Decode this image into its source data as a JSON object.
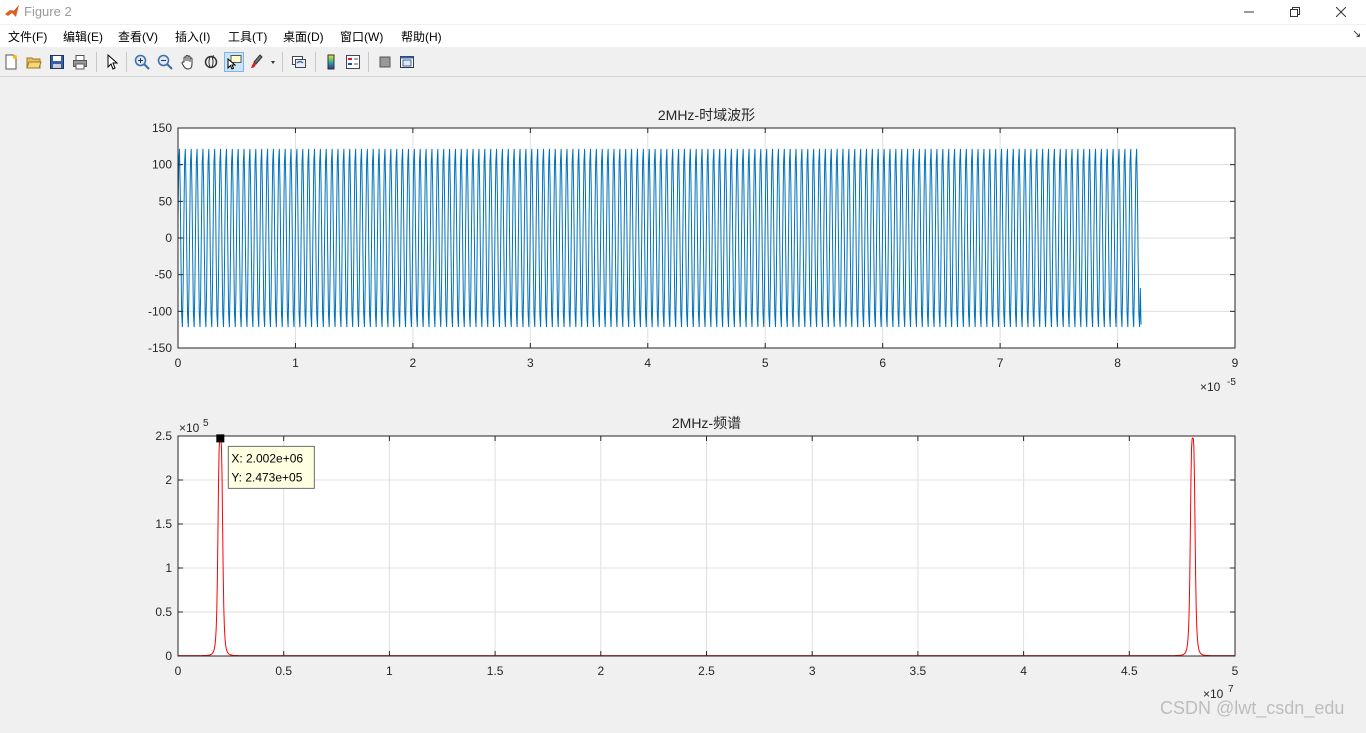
{
  "window": {
    "title": "Figure 2",
    "app_icon": "matlab-icon",
    "controls": [
      "minimize-icon",
      "maximize-icon",
      "close-icon"
    ]
  },
  "menu": [
    "文件(F)",
    "编辑(E)",
    "查看(V)",
    "插入(I)",
    "工具(T)",
    "桌面(D)",
    "窗口(W)",
    "帮助(H)"
  ],
  "toolbar": {
    "icons": [
      "new-figure-icon",
      "open-file-icon",
      "save-icon",
      "print-icon",
      "select-arrow-icon",
      "zoom-in-icon",
      "zoom-out-icon",
      "pan-hand-icon",
      "rotate-3d-icon",
      "data-cursor-icon",
      "brush-icon",
      "link-plot-icon",
      "colorbar-icon",
      "legend-icon",
      "hide-plot-tools-icon",
      "show-plot-tools-icon"
    ],
    "active": "data-cursor-icon"
  },
  "chart_data": [
    {
      "type": "line",
      "title": "2MHz-时域波形",
      "xlabel": "",
      "ylabel": "",
      "xlim": [
        0,
        9
      ],
      "ylim": [
        -150,
        150
      ],
      "x_ticks": [
        "0",
        "1",
        "2",
        "3",
        "4",
        "5",
        "6",
        "7",
        "8",
        "9"
      ],
      "y_ticks": [
        "150",
        "100",
        "50",
        "0",
        "-50",
        "-100",
        "-150"
      ],
      "x_exponent": "-5",
      "grid": true,
      "line_color": "#0072bd",
      "series": [
        {
          "kind": "sine",
          "amplitude": 124,
          "x_start": 0,
          "x_end": 8.2,
          "cycles": 164,
          "start_value": 25,
          "end_value": -118
        }
      ]
    },
    {
      "type": "line",
      "title": "2MHz-频谱",
      "xlabel": "",
      "ylabel": "",
      "xlim": [
        0,
        5
      ],
      "ylim": [
        0,
        2.5
      ],
      "x_ticks": [
        "0",
        "0.5",
        "1",
        "1.5",
        "2",
        "2.5",
        "3",
        "3.5",
        "4",
        "4.5",
        "5"
      ],
      "y_ticks": [
        "2.5",
        "2",
        "1.5",
        "1",
        "0.5",
        "0"
      ],
      "x_exponent": "7",
      "y_exponent": "5",
      "grid": true,
      "line_color": "#ff0000",
      "peaks": [
        {
          "x": 0.2002,
          "y": 2.473
        },
        {
          "x": 4.8,
          "y": 2.473
        }
      ],
      "datatip": {
        "x": 0.2002,
        "y": 2.473,
        "lines": [
          "X: 2.002e+06",
          "Y: 2.473e+05"
        ]
      }
    }
  ],
  "watermark": "CSDN @lwt_csdn_edu"
}
